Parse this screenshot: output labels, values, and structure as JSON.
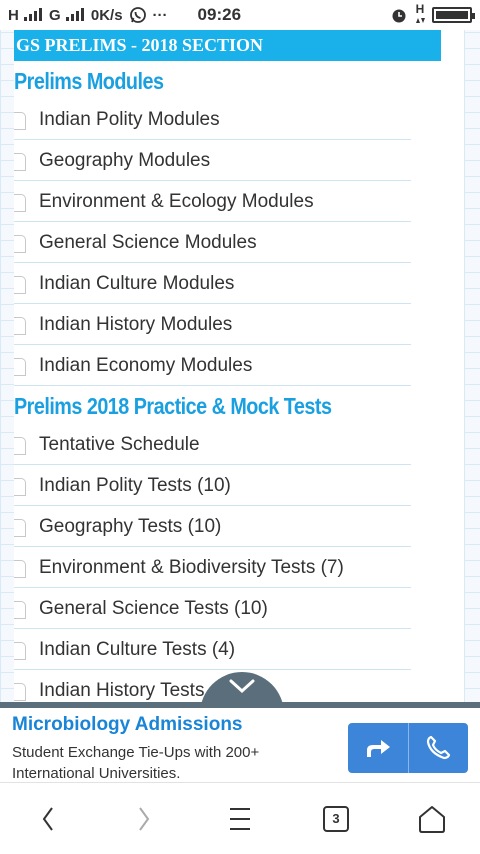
{
  "status_bar": {
    "signal1": "H",
    "signal2": "G",
    "speed": "0K/s",
    "more": "···",
    "time": "09:26",
    "network": "H"
  },
  "section_header": "GS PRELIMS - 2018 SECTION",
  "groups": [
    {
      "title": "Prelims Modules",
      "items": [
        "Indian Polity Modules",
        "Geography Modules",
        "Environment & Ecology Modules",
        "General Science Modules",
        "Indian Culture Modules",
        "Indian History Modules",
        "Indian Economy Modules"
      ]
    },
    {
      "title": "Prelims 2018 Practice & Mock Tests",
      "items": [
        "Tentative Schedule",
        "Indian Polity Tests (10)",
        "Geography Tests (10)",
        "Environment & Biodiversity Tests (7)",
        "General Science Tests (10)",
        "Indian Culture Tests (4)",
        "Indian History Tests"
      ]
    }
  ],
  "ad": {
    "title": "Microbiology Admissions",
    "text": "Student Exchange Tie-Ups with 200+ International Universities."
  },
  "nav": {
    "tab_count": "3"
  },
  "colors": {
    "accent": "#1ab0ea",
    "ad_button": "#3d85d8",
    "ad_title": "#1a84d6"
  }
}
